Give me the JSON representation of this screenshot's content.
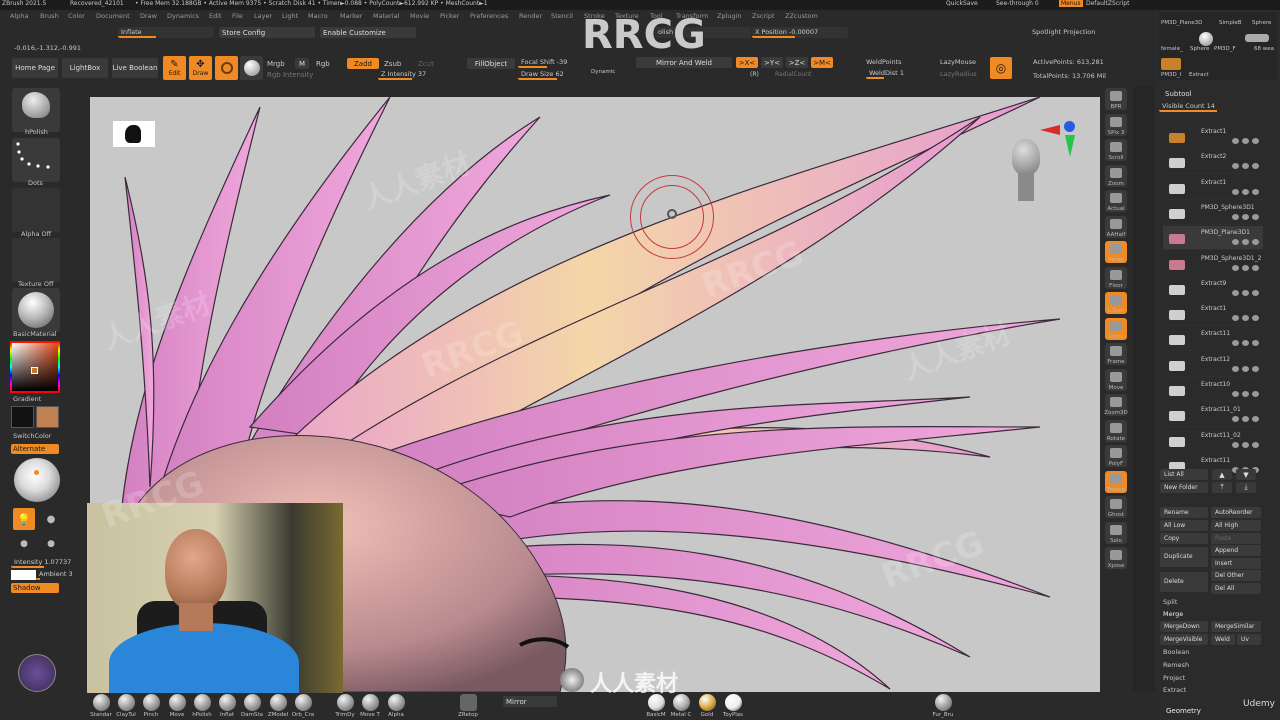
{
  "title_bar": {
    "app": "ZBrush 2021.5",
    "document": "Recovered_42101",
    "status": "• Free Mem 32.188GB • Active Mem 9375 • Scratch Disk 41 • Timer►0.088 • PolyCount►612.992 KP • MeshCount►1",
    "quicksave": "QuickSave",
    "seethrough": "See-through  0",
    "menus": "Menus",
    "script": "DefaultZScript"
  },
  "menu_bar": [
    "Alpha",
    "Brush",
    "Color",
    "Document",
    "Draw",
    "Dynamics",
    "Edit",
    "File",
    "Layer",
    "Light",
    "Macro",
    "Marker",
    "Material",
    "Movie",
    "Picker",
    "Preferences",
    "Render",
    "Stencil",
    "Stroke",
    "Texture",
    "Tool",
    "Transform",
    "Zplugin",
    "Zscript",
    "ZZcustom"
  ],
  "toolbar_row1": {
    "inflate": "Inflate",
    "store_config": "Store Config",
    "enable_customize": "Enable Customize",
    "polish": "olish",
    "x_position": "X Position -0.00007",
    "spotlight": "Spotlight Projection",
    "coords": "-0.016,-1.312,-0.991"
  },
  "toolbar_row2": {
    "home_page": "Home Page",
    "lightbox": "LightBox",
    "live_boolean": "Live Boolean",
    "edit": "Edit",
    "draw": "Draw",
    "mrgb": "Mrgb",
    "m": "M",
    "rgb": "Rgb",
    "rgb_intensity": "Rgb Intensity",
    "zadd": "Zadd",
    "zsub": "Zsub",
    "zcut": "Zcut",
    "z_intensity_label": "Z Intensity",
    "z_intensity_value": "37",
    "fill_object": "FillObject",
    "focal_shift_label": "Focal Shift",
    "focal_shift_value": "-39",
    "draw_size_label": "Draw Size",
    "draw_size_value": "62",
    "dynamic": "Dynamic",
    "mirror_and_weld": "Mirror And Weld",
    "sym_x": ">X<",
    "sym_y": ">Y<",
    "sym_z": ">Z<",
    "sym_m": ">M<",
    "sym_r": "(R)",
    "radial_count": "RadialCount",
    "weld_points": "WeldPoints",
    "weld_dist_label": "WeldDist",
    "weld_dist_value": "1",
    "lazy_mouse": "LazyMouse",
    "lazy_radius": "LazyRadius",
    "active_points": "ActivePoints: 613,281",
    "total_points": "TotalPoints: 13.706 Mil"
  },
  "left_tray": {
    "brush": "hPolish",
    "stroke": "Dots",
    "alpha": "Alpha Off",
    "texture": "Texture Off",
    "material": "BasicMaterial",
    "gradient": "Gradient",
    "switch_color": "SwitchColor",
    "alternate": "Alternate",
    "intensity": "Intensity 1.07737",
    "ambient": "Ambient 3",
    "shadow": "Shadow",
    "colors": {
      "main": "#f08a24",
      "secondary": "#c08050",
      "black": "#111111"
    }
  },
  "right_shelf": [
    {
      "name": "bpr",
      "label": "BPR"
    },
    {
      "name": "spix",
      "label": "SPix 3"
    },
    {
      "name": "scroll",
      "label": "Scroll"
    },
    {
      "name": "zoom",
      "label": "Zoom"
    },
    {
      "name": "actual",
      "label": "Actual"
    },
    {
      "name": "aahalf",
      "label": "AAHalf"
    },
    {
      "name": "persp",
      "label": "Persp"
    },
    {
      "name": "floor",
      "label": "Floor"
    },
    {
      "name": "lsym",
      "label": "L.Sym"
    },
    {
      "name": "qxyz",
      "label": "Qxyz"
    },
    {
      "name": "frame",
      "label": "Frame"
    },
    {
      "name": "move",
      "label": "Move"
    },
    {
      "name": "zoom3d",
      "label": "Zoom3D"
    },
    {
      "name": "rotate",
      "label": "Rotate"
    },
    {
      "name": "polyf",
      "label": "PolyF"
    },
    {
      "name": "transp",
      "label": "Transp"
    },
    {
      "name": "ghost",
      "label": "Ghost"
    },
    {
      "name": "solo",
      "label": "Solo"
    },
    {
      "name": "xpose",
      "label": "Xpose"
    }
  ],
  "right_panel": {
    "tool_thumbs": [
      "PM3D_Plane3D",
      "SimpleB",
      "Sphere",
      "female_",
      "Sphere",
      "PM3D_F",
      "68 wea",
      "PM3D_I",
      "Extract"
    ],
    "subtool_header": "Subtool",
    "visible_count": "Visible Count 14",
    "subtools": [
      "Extract1",
      "Extract2",
      "Extract1",
      "PM3D_Sphere3D1",
      "PM3D_Plane3D1",
      "PM3D_Sphere3D1_2",
      "Extract9",
      "Extract1",
      "Extract11",
      "Extract12",
      "Extract10",
      "Extract11_01",
      "Extract11_02",
      "Extract11"
    ],
    "list_all": "List All",
    "new_folder": "New Folder",
    "rename": "Rename",
    "auto_reorder": "AutoReorder",
    "all_low": "All Low",
    "all_high": "All High",
    "copy": "Copy",
    "paste": "Paste",
    "duplicate": "Duplicate",
    "append": "Append",
    "insert": "Insert",
    "delete": "Delete",
    "del_other": "Del Other",
    "del_all": "Del All",
    "split": "Split",
    "merge": "Merge",
    "merge_down": "MergeDown",
    "merge_similar": "MergeSimilar",
    "merge_visible": "MergeVisible",
    "weld": "Weld",
    "uv": "Uv",
    "boolean": "Boolean",
    "remesh": "Remesh",
    "project": "Project",
    "extract": "Extract",
    "geometry": "Geometry"
  },
  "bottom_bar": {
    "brushes": [
      "Standar",
      "ClayTul",
      "Pinch",
      "Move",
      "hPolish",
      "Inflat",
      "DamSta",
      "ZModel",
      "Orb_Cra",
      "TrimDy",
      "Move T",
      "Alpha"
    ],
    "zretop": "ZRetop",
    "mirror": "Mirror",
    "materials": [
      "BasicM",
      "Metal C",
      "Gold",
      "ToyPlas"
    ],
    "fur": "Fur_Bru"
  },
  "watermarks": {
    "brand": "RRCG",
    "cn": "人人素材",
    "udemy": "Udemy"
  }
}
